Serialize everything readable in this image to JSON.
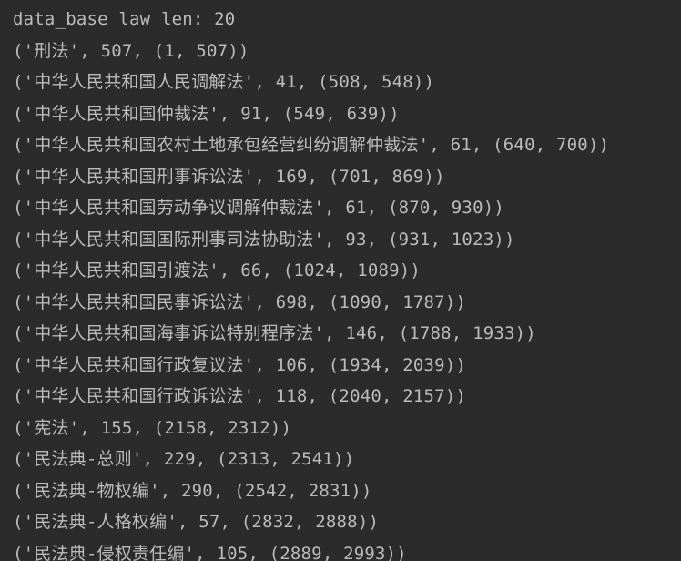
{
  "console": {
    "lines": [
      "data_base law len: 20",
      "('刑法', 507, (1, 507))",
      "('中华人民共和国人民调解法', 41, (508, 548))",
      "('中华人民共和国仲裁法', 91, (549, 639))",
      "('中华人民共和国农村土地承包经营纠纷调解仲裁法', 61, (640, 700))",
      "('中华人民共和国刑事诉讼法', 169, (701, 869))",
      "('中华人民共和国劳动争议调解仲裁法', 61, (870, 930))",
      "('中华人民共和国国际刑事司法协助法', 93, (931, 1023))",
      "('中华人民共和国引渡法', 66, (1024, 1089))",
      "('中华人民共和国民事诉讼法', 698, (1090, 1787))",
      "('中华人民共和国海事诉讼特别程序法', 146, (1788, 1933))",
      "('中华人民共和国行政复议法', 106, (1934, 2039))",
      "('中华人民共和国行政诉讼法', 118, (2040, 2157))",
      "('宪法', 155, (2158, 2312))",
      "('民法典-总则', 229, (2313, 2541))",
      "('民法典-物权编', 290, (2542, 2831))",
      "('民法典-人格权编', 57, (2832, 2888))",
      "('民法典-侵权责任编', 105, (2889, 2993))"
    ]
  },
  "colors": {
    "background": "#2b2b2b",
    "text": "#bbbbbb"
  }
}
